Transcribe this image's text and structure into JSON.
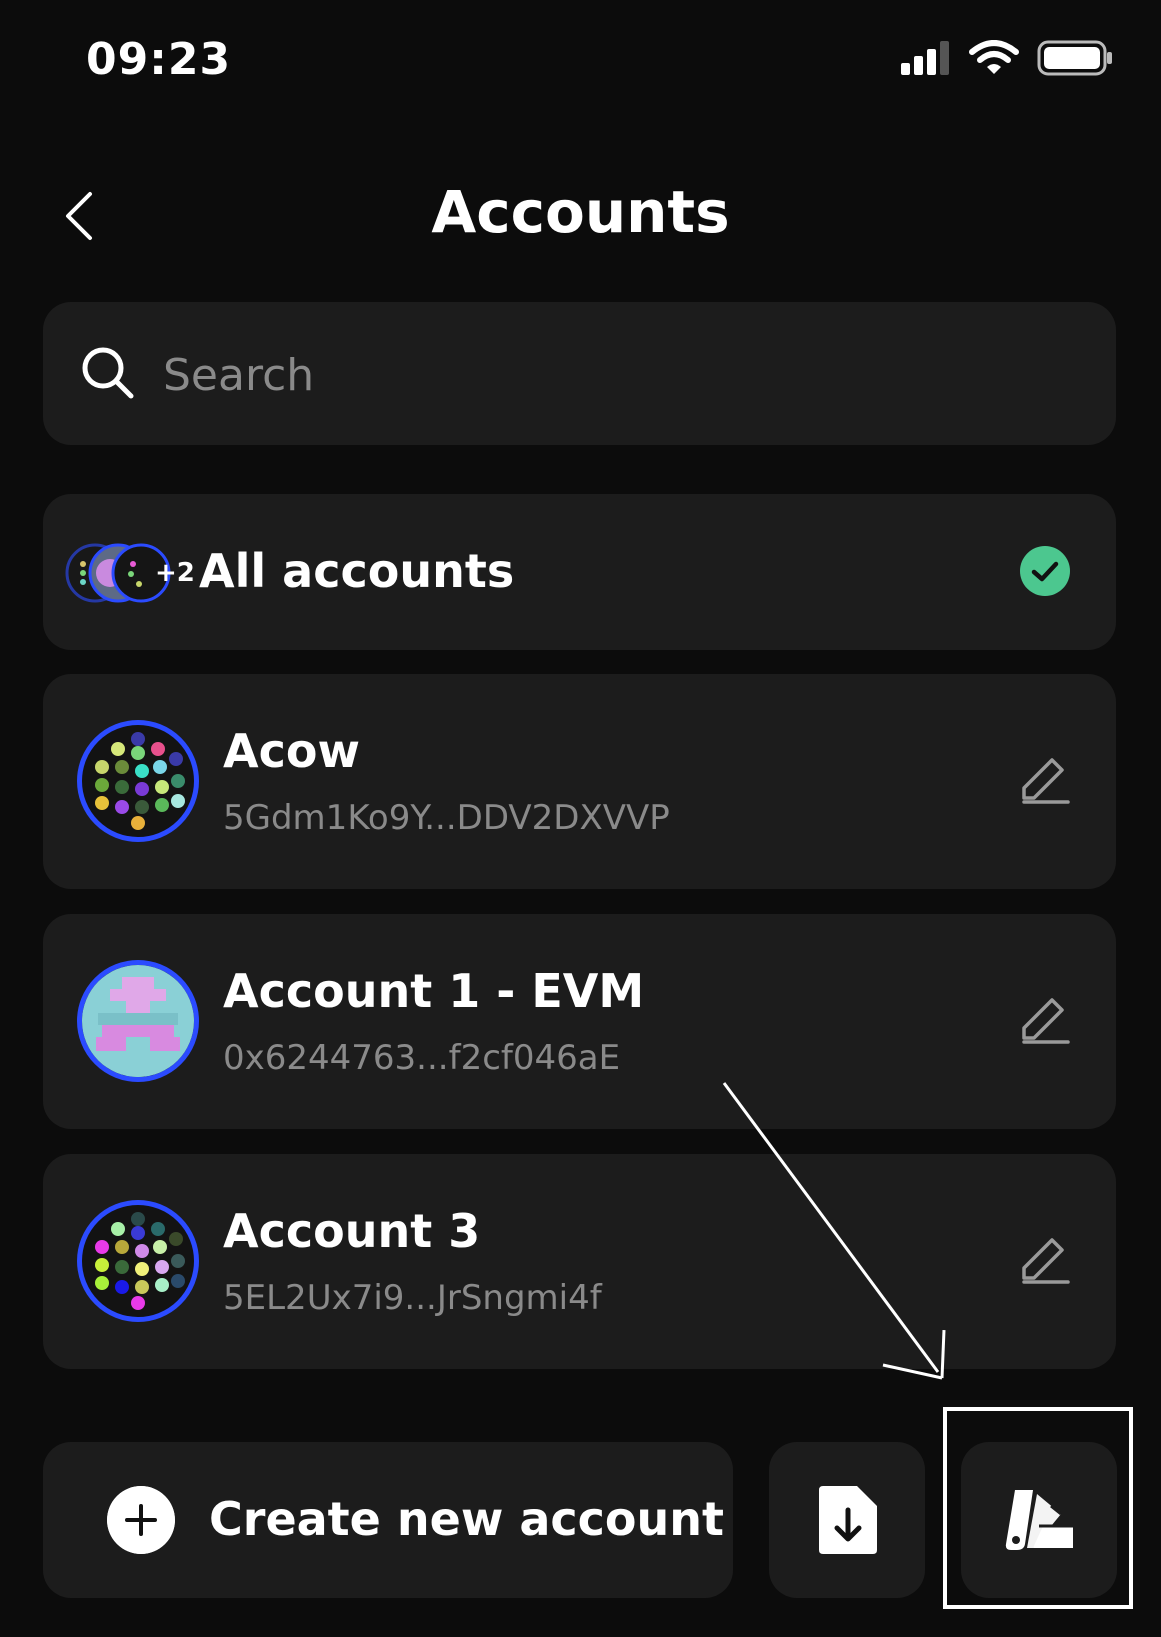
{
  "status_bar": {
    "time": "09:23"
  },
  "header": {
    "title": "Accounts"
  },
  "search": {
    "placeholder": "Search",
    "value": ""
  },
  "all_accounts": {
    "label": "All accounts",
    "extra_count": "+2",
    "selected": true
  },
  "accounts": [
    {
      "name": "Acow",
      "address": "5Gdm1Ko9Y...DDV2DXVVP"
    },
    {
      "name": "Account 1 - EVM",
      "address": "0x6244763...f2cf046aE"
    },
    {
      "name": "Account 3",
      "address": "5EL2Ux7i9...JrSngmi4f"
    }
  ],
  "footer": {
    "create_label": "Create new account"
  },
  "colors": {
    "accent": "#2b4bff",
    "check": "#4cc78f",
    "card": "#1c1c1c",
    "background": "#0c0c0c"
  }
}
